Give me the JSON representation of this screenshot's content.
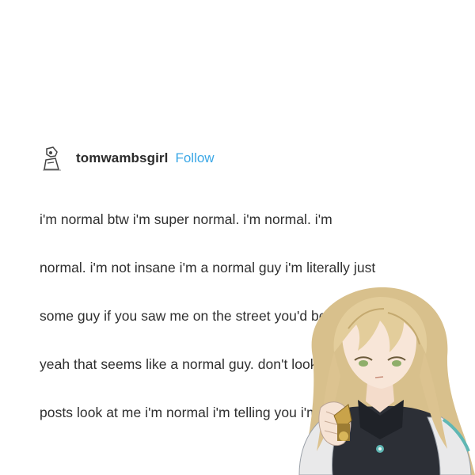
{
  "post": {
    "username": "tomwambsgirl",
    "follow_label": "Follow",
    "lines": [
      "i'm normal btw i'm super normal. i'm normal. i'm",
      "normal. i'm not insane i'm a normal guy i'm literally just",
      "some guy if you saw me on the street you'd be like",
      "yeah that seems like a normal guy. don't look at my",
      "posts look at me i'm normal i'm telling you i'm normal"
    ]
  },
  "icons": {
    "avatar": "cartoon-avatar-icon",
    "character": "anime-character-sticker"
  },
  "colors": {
    "username": "#2b2b2b",
    "follow": "#3aa7e6",
    "body_text": "#2f2f2f",
    "background": "#ffffff"
  }
}
